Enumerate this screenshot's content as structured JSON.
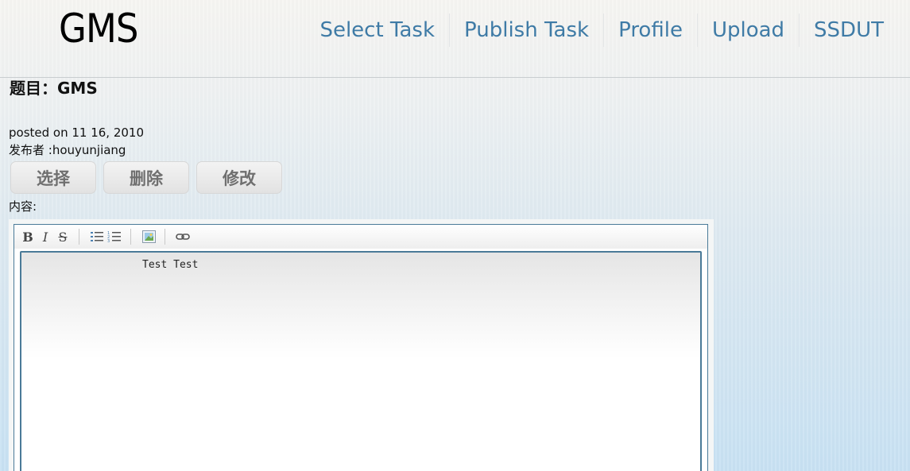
{
  "header": {
    "logo": "GMS",
    "nav": [
      "Select Task",
      "Publish Task",
      "Profile",
      "Upload",
      "SSDUT"
    ]
  },
  "task": {
    "title": "题目：GMS",
    "posted": "posted on 11 16, 2010",
    "author": "发布者 :houyunjiang",
    "content_label": "内容:"
  },
  "actions": {
    "select": "选择",
    "delete": "删除",
    "edit": "修改"
  },
  "editor": {
    "toolbar": [
      "bold-icon",
      "italic-icon",
      "strikethrough-icon",
      "bulleted-list-icon",
      "numbered-list-icon",
      "image-icon",
      "link-icon"
    ],
    "text": "Test Test"
  }
}
